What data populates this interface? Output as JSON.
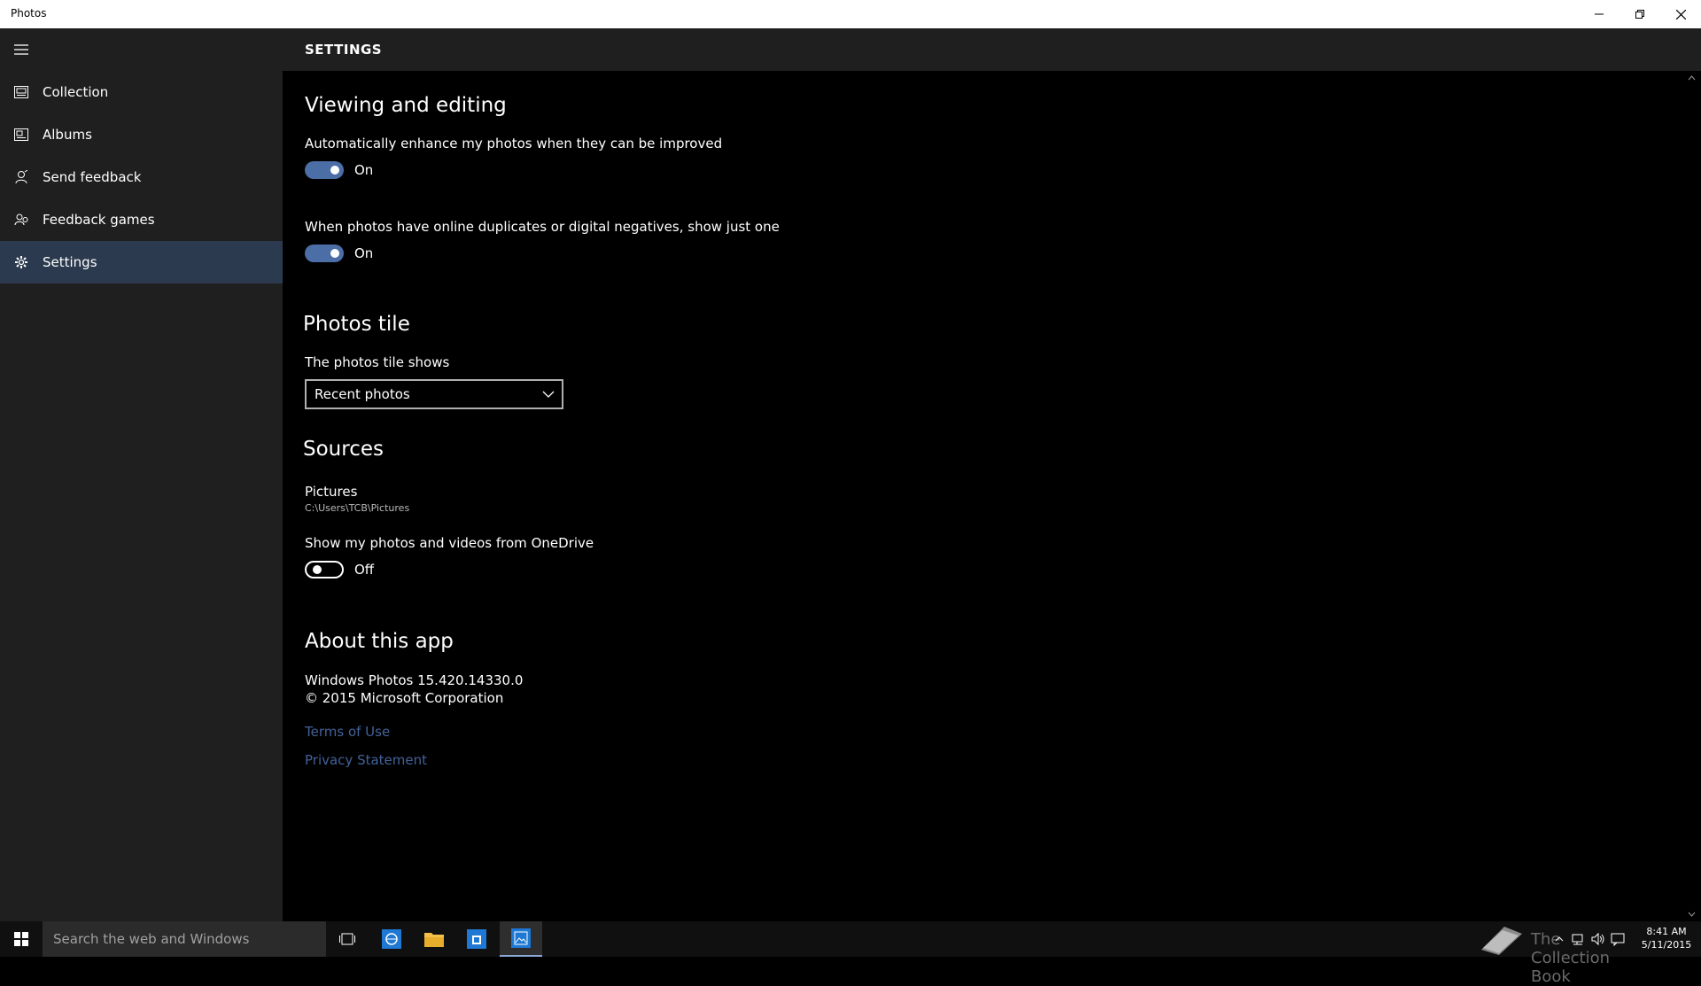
{
  "window": {
    "title": "Photos"
  },
  "sidebar": {
    "items": [
      {
        "label": "Collection",
        "icon": "collection-icon"
      },
      {
        "label": "Albums",
        "icon": "albums-icon"
      },
      {
        "label": "Send feedback",
        "icon": "feedback-icon"
      },
      {
        "label": "Feedback games",
        "icon": "feedback-games-icon"
      },
      {
        "label": "Settings",
        "icon": "gear-icon",
        "selected": true
      }
    ]
  },
  "header": {
    "title": "SETTINGS"
  },
  "viewing": {
    "heading": "Viewing and editing",
    "enhance_label": "Automatically enhance my photos when they can be improved",
    "enhance_state": "On",
    "duplicates_label": "When photos have online duplicates or digital negatives, show just one",
    "duplicates_state": "On"
  },
  "tile": {
    "heading": "Photos tile",
    "label": "The photos tile shows",
    "selected": "Recent photos"
  },
  "sources": {
    "heading": "Sources",
    "folder_name": "Pictures",
    "folder_path": "C:\\Users\\TCB\\Pictures",
    "onedrive_label": "Show my photos and videos from OneDrive",
    "onedrive_state": "Off"
  },
  "about": {
    "heading": "About this app",
    "version": "Windows Photos 15.420.14330.0",
    "copyright": "© 2015 Microsoft Corporation",
    "terms_link": "Terms of Use",
    "privacy_link": "Privacy Statement"
  },
  "taskbar": {
    "search_placeholder": "Search the web and Windows",
    "watermark": "The Collection Book",
    "time": "8:41 AM",
    "date": "5/11/2015"
  },
  "colors": {
    "accent": "#4c6ea6",
    "sidebar_bg": "#1f1f1f",
    "selected_bg": "#2b3a4e",
    "link": "#42629a"
  }
}
